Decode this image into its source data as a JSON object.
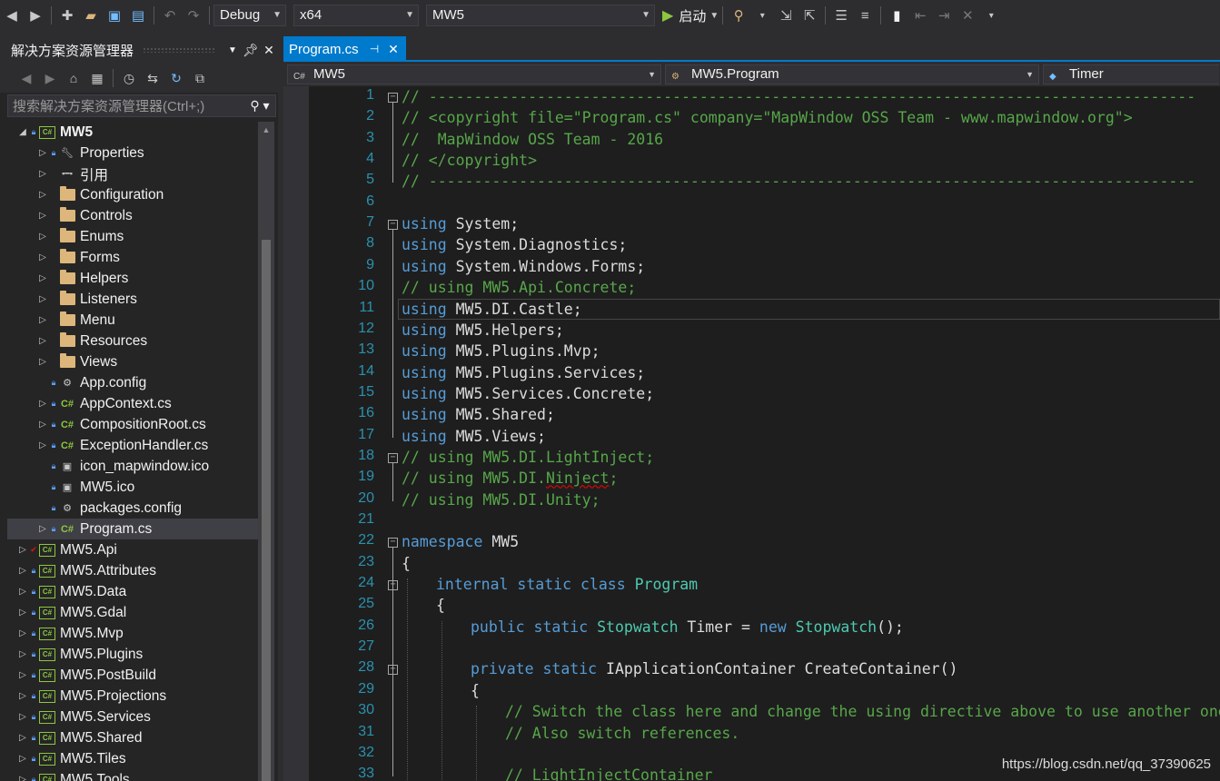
{
  "toolbar": {
    "config": "Debug",
    "platform": "x64",
    "project": "MW5",
    "start_label": "启动"
  },
  "solution_explorer": {
    "title": "解决方案资源管理器",
    "search_placeholder": "搜索解决方案资源管理器(Ctrl+;)",
    "items": [
      {
        "label": "MW5",
        "icon": "csharp-project-icon",
        "level": 0,
        "expanded": true,
        "bold": true
      },
      {
        "label": "Properties",
        "icon": "wrench-icon",
        "level": 1
      },
      {
        "label": "引用",
        "icon": "references-icon",
        "level": 1
      },
      {
        "label": "Configuration",
        "icon": "folder-icon",
        "level": 1
      },
      {
        "label": "Controls",
        "icon": "folder-icon",
        "level": 1
      },
      {
        "label": "Enums",
        "icon": "folder-icon",
        "level": 1
      },
      {
        "label": "Forms",
        "icon": "folder-icon",
        "level": 1
      },
      {
        "label": "Helpers",
        "icon": "folder-icon",
        "level": 1
      },
      {
        "label": "Listeners",
        "icon": "folder-icon",
        "level": 1
      },
      {
        "label": "Menu",
        "icon": "folder-icon",
        "level": 1
      },
      {
        "label": "Resources",
        "icon": "folder-icon",
        "level": 1
      },
      {
        "label": "Views",
        "icon": "folder-icon",
        "level": 1
      },
      {
        "label": "App.config",
        "icon": "config-file-icon",
        "level": 1
      },
      {
        "label": "AppContext.cs",
        "icon": "csharp-file-icon",
        "level": 1
      },
      {
        "label": "CompositionRoot.cs",
        "icon": "csharp-file-icon",
        "level": 1
      },
      {
        "label": "ExceptionHandler.cs",
        "icon": "csharp-file-icon",
        "level": 1
      },
      {
        "label": "icon_mapwindow.ico",
        "icon": "ico-file-icon",
        "level": 1
      },
      {
        "label": "MW5.ico",
        "icon": "ico-file-icon",
        "level": 1
      },
      {
        "label": "packages.config",
        "icon": "config-file-icon",
        "level": 1
      },
      {
        "label": "Program.cs",
        "icon": "csharp-file-icon",
        "level": 1,
        "selected": true
      },
      {
        "label": "MW5.Api",
        "icon": "csharp-project-icon",
        "level": 0
      },
      {
        "label": "MW5.Attributes",
        "icon": "csharp-project-icon",
        "level": 0
      },
      {
        "label": "MW5.Data",
        "icon": "csharp-project-icon",
        "level": 0
      },
      {
        "label": "MW5.Gdal",
        "icon": "csharp-project-icon",
        "level": 0
      },
      {
        "label": "MW5.Mvp",
        "icon": "csharp-project-icon",
        "level": 0
      },
      {
        "label": "MW5.Plugins",
        "icon": "csharp-project-icon",
        "level": 0
      },
      {
        "label": "MW5.PostBuild",
        "icon": "csharp-project-icon",
        "level": 0
      },
      {
        "label": "MW5.Projections",
        "icon": "csharp-project-icon",
        "level": 0
      },
      {
        "label": "MW5.Services",
        "icon": "csharp-project-icon",
        "level": 0
      },
      {
        "label": "MW5.Shared",
        "icon": "csharp-project-icon",
        "level": 0
      },
      {
        "label": "MW5.Tiles",
        "icon": "csharp-project-icon",
        "level": 0
      },
      {
        "label": "MW5.Tools",
        "icon": "csharp-project-icon",
        "level": 0
      }
    ]
  },
  "editor": {
    "tab_label": "Program.cs",
    "nav_project": "MW5",
    "nav_class": "MW5.Program",
    "nav_member": "Timer",
    "lines": [
      {
        "n": "1",
        "text": "// -------------------------------------------------------------------------------------"
      },
      {
        "n": "2",
        "text": "// <copyright file=\"Program.cs\" company=\"MapWindow OSS Team - www.mapwindow.org\">"
      },
      {
        "n": "3",
        "text": "//  MapWindow OSS Team - 2016"
      },
      {
        "n": "4",
        "text": "// </copyright>"
      },
      {
        "n": "5",
        "text": "// -------------------------------------------------------------------------------------"
      },
      {
        "n": "6",
        "text": ""
      },
      {
        "n": "7",
        "text": "using System;"
      },
      {
        "n": "8",
        "text": "using System.Diagnostics;"
      },
      {
        "n": "9",
        "text": "using System.Windows.Forms;"
      },
      {
        "n": "10",
        "text": "// using MW5.Api.Concrete;"
      },
      {
        "n": "11",
        "text": "using MW5.DI.Castle;"
      },
      {
        "n": "12",
        "text": "using MW5.Helpers;"
      },
      {
        "n": "13",
        "text": "using MW5.Plugins.Mvp;"
      },
      {
        "n": "14",
        "text": "using MW5.Plugins.Services;"
      },
      {
        "n": "15",
        "text": "using MW5.Services.Concrete;"
      },
      {
        "n": "16",
        "text": "using MW5.Shared;"
      },
      {
        "n": "17",
        "text": "using MW5.Views;"
      },
      {
        "n": "18",
        "text": "// using MW5.DI.LightInject;"
      },
      {
        "n": "19",
        "text": "// using MW5.DI.Ninject;"
      },
      {
        "n": "20",
        "text": "// using MW5.DI.Unity;"
      },
      {
        "n": "21",
        "text": ""
      },
      {
        "n": "22",
        "text": "namespace MW5"
      },
      {
        "n": "23",
        "text": "{"
      },
      {
        "n": "24",
        "text": "internal static class Program"
      },
      {
        "n": "25",
        "text": "{"
      },
      {
        "n": "26",
        "text": "public static Stopwatch Timer = new Stopwatch();"
      },
      {
        "n": "27",
        "text": ""
      },
      {
        "n": "28",
        "text": "private static IApplicationContainer CreateContainer()"
      },
      {
        "n": "29",
        "text": "{"
      },
      {
        "n": "30",
        "text": "// Switch the class here and change the using directive above to use another one"
      },
      {
        "n": "31",
        "text": "// Also switch references."
      },
      {
        "n": "32",
        "text": ""
      },
      {
        "n": "33",
        "text": "// LightInjectContainer"
      }
    ]
  },
  "watermark": "https://blog.csdn.net/qq_37390625"
}
